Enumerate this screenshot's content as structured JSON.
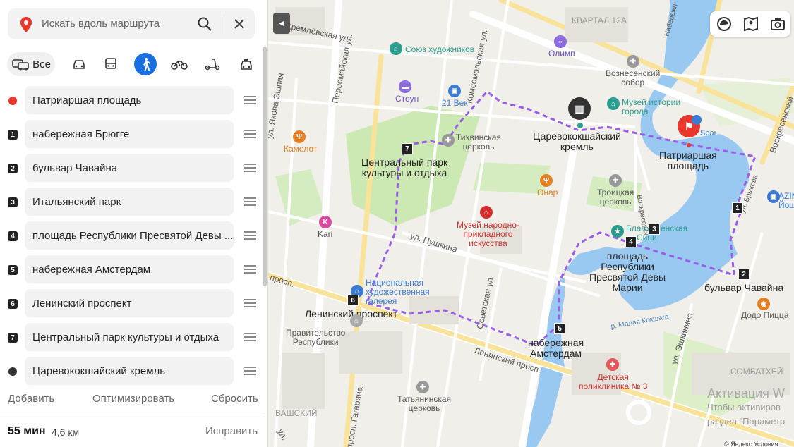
{
  "search": {
    "placeholder": "Искать вдоль маршрута"
  },
  "modes": {
    "all_label": "Все",
    "active": "pedestrian"
  },
  "waypoints": [
    {
      "marker": "",
      "label": "Патриаршая площадь"
    },
    {
      "marker": "1",
      "label": "набережная Брюгге"
    },
    {
      "marker": "2",
      "label": "бульвар Чавайна"
    },
    {
      "marker": "3",
      "label": "Итальянский парк"
    },
    {
      "marker": "4",
      "label": "площадь Республики Пресвятой Девы ..."
    },
    {
      "marker": "5",
      "label": "набережная Амстердам"
    },
    {
      "marker": "6",
      "label": "Ленинский проспект"
    },
    {
      "marker": "7",
      "label": "Центральный парк культуры и отдыха"
    },
    {
      "marker": "",
      "label": "Царевококшайский кремль"
    }
  ],
  "actions": {
    "add": "Добавить",
    "optimize": "Оптимизировать",
    "reset": "Сбросить"
  },
  "summary": {
    "time": "55 мин",
    "distance": "4,6 км",
    "fix": "Исправить"
  },
  "map": {
    "streets": {
      "kremlevskaya": "Кремлёвская ул.",
      "pervomayskaya": "Первомайская ул.",
      "komsomolskaya": "Комсомольская ул.",
      "yoshkinaya": "ул. Якова Эшпая",
      "pushkina": "ул. Пушкина",
      "sovetskaya": "Советская ул.",
      "leninsky1": "просп.",
      "leninsky2": "Ленинский просп.",
      "gagarina": "просп. Гагарина",
      "eshkinina": "ул. Эшкинина",
      "voskres1": "Воскресенский",
      "voskres2": "Воскресенск",
      "bravik": "ул. Брыкова",
      "naberezh": "Набережн",
      "kochka": "р. Малая Кокшага",
      "ul": "ул."
    },
    "places": {
      "kvartal": "КВАРТАЛ 12А",
      "olimp": "Олимп",
      "soyuz": "Союз художников",
      "stoun": "Стоун",
      "vek": "21 Век",
      "tikh": "Тихвинская\nцерковь",
      "voznes": "Вознесенский\nсобор",
      "muzey_ist": "Музей истории\nгорода",
      "kamelot": "Камелот",
      "kremlin": "Царевококшайский\nкремль",
      "patr": "Патриаршая\nплощадь",
      "spar": "Spar",
      "park": "Центральный парк\nкультуры и отдыха",
      "onar": "Онар",
      "troick": "Троицкая\nцерковь",
      "azimut": "AZIM\nЙош",
      "muzey_nar": "Музей народно-\nприкладного\nискусства",
      "kari": "Kari",
      "blago": "Благо",
      "blago2": "енская",
      "sinii": "Сини",
      "ploshchad": "площадь\nРеспублики\nПресвятой Девы\nМарии",
      "bulvar": "бульвар Чавайна",
      "dodo": "Додо Пицца",
      "galereya": "Национальная\nхудожественная\nгалерея",
      "leninsky": "Ленинский проспект",
      "pravit": "Правительство\nРеспублики",
      "amsterdam": "набережная\nАмстердам",
      "poliklinika": "Детская\nполиклиника № 3",
      "sombatkhey": "СОМБАТХЕЙ",
      "tatyan": "Татьянинская\nцерковь",
      "vashsky": "ВАШСКИЙ"
    },
    "watermark": {
      "title": "Активация W",
      "line1": "Чтобы активиров",
      "line2": "раздел \"Параметр"
    },
    "copyright": "© Яндекс Условия"
  }
}
